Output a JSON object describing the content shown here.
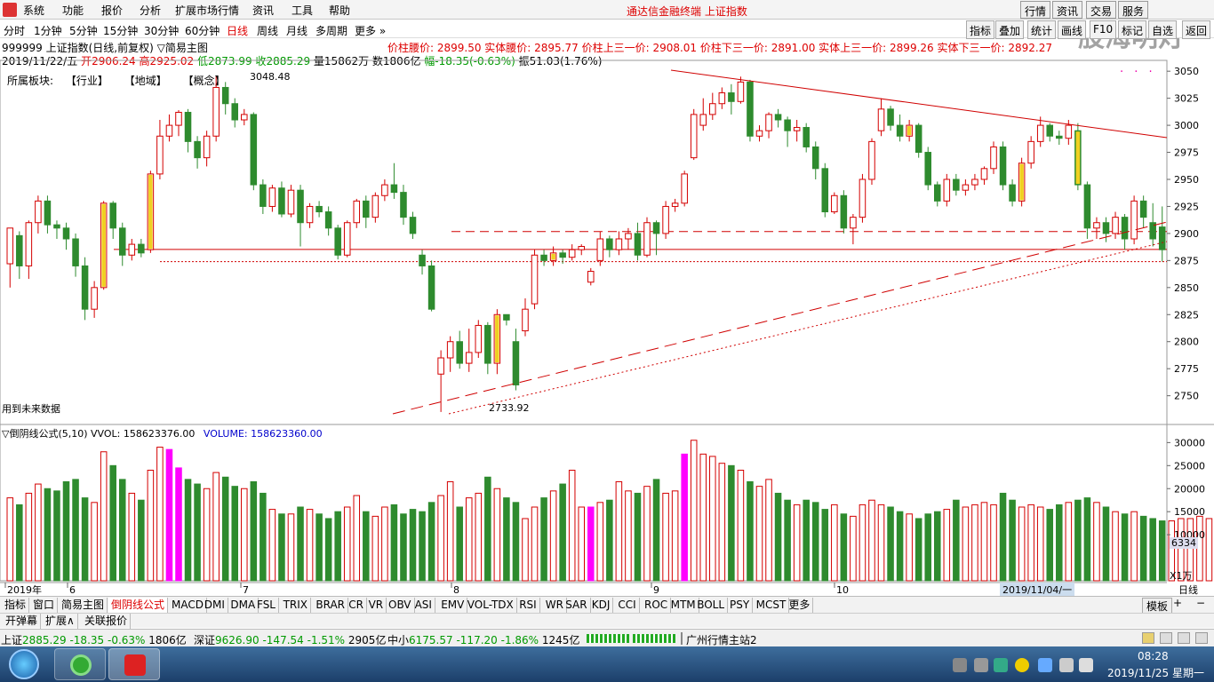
{
  "menu": {
    "items": [
      "系统",
      "功能",
      "报价",
      "分析",
      "扩展市场行情",
      "资讯",
      "工具",
      "帮助"
    ],
    "app_title": "通达信金融终端 上证指数",
    "right_tabs": [
      "行情",
      "资讯",
      "交易",
      "服务"
    ],
    "watermark": "股海明灯"
  },
  "periods": [
    "分时",
    "1分钟",
    "5分钟",
    "15分钟",
    "30分钟",
    "60分钟",
    "日线",
    "周线",
    "月线",
    "多周期",
    "更多"
  ],
  "period_active": "日线",
  "side_tabs": [
    "指标",
    "叠加",
    "统计",
    "画线",
    "F10",
    "标记",
    "自选",
    "返回"
  ],
  "header": {
    "code_name": "999999 上证指数(日线,前复权)",
    "template": "▽简易主图",
    "price_levels": "价柱腰价: 2899.50 实体腰价: 2895.77 价柱上三一价: 2908.01 价柱下三一价: 2891.00 实体上三一价: 2899.26 实体下三一价: 2892.27",
    "date": "2019/11/22/五",
    "open_label": "开",
    "open": "2906.24",
    "high_label": "高",
    "high": "2925.02",
    "low_label": "低",
    "low": "2873.99",
    "close_label": "收",
    "close": "2885.29",
    "vol": "量15862万 数1806亿",
    "change": "幅-18.35(-0.63%)",
    "amplitude": "振51.03(1.76%)",
    "sector_label": "所属板块:",
    "sector_industry": "【行业】",
    "sector_region": "【地域】",
    "sector_concept": "【概念】"
  },
  "annotations": {
    "high_label": "3048.48",
    "low_label": "2733.92",
    "future_data_note": "用到未来数据"
  },
  "volume_panel": {
    "title": "▽倒阴线公式(5,10) VVOL: 158623376.00",
    "volume_label": "VOLUME: 158623360.00",
    "current_value": "6334",
    "scale_unit": "X1万"
  },
  "x_axis": {
    "labels": [
      "2019年",
      "6",
      "7",
      "8",
      "9",
      "10"
    ],
    "cursor_date": "2019/11/04/一",
    "period": "日线"
  },
  "indicator_tabs": [
    "指标",
    "窗口",
    "简易主图",
    "倒阴线公式",
    "MACD",
    "DMI",
    "DMA",
    "FSL",
    "TRIX",
    "BRAR",
    "CR",
    "VR",
    "OBV",
    "ASI",
    "EMV",
    "VOL-TDX",
    "RSI",
    "WR",
    "SAR",
    "KDJ",
    "CCI",
    "ROC",
    "MTM",
    "BOLL",
    "PSY",
    "MCST",
    "更多"
  ],
  "indicator_active": "倒阴线公式",
  "template_button": "模板",
  "subtabs": [
    "开弹幕",
    "扩展∧",
    "关联报价"
  ],
  "status": {
    "sh_label": "上证",
    "sh_value": "2885.29",
    "sh_change": "-18.35",
    "sh_pct": "-0.63%",
    "sh_amount": "1806亿",
    "sz_label": "深证",
    "sz_value": "9626.90",
    "sz_change": "-147.54",
    "sz_pct": "-1.51%",
    "sz_amount": "2905亿",
    "zx_label": "中小",
    "zx_value": "6175.57",
    "zx_change": "-117.20",
    "zx_pct": "-1.86%",
    "zx_amount": "1245亿",
    "server": "广州行情主站2"
  },
  "taskbar": {
    "time": "08:28",
    "date": "2019/11/25 星期一"
  },
  "colors": {
    "up": "#d40000",
    "down": "#2e8b2e",
    "doji": "#f0d020",
    "magenta": "#ff00ff",
    "accent": "#d00000"
  },
  "chart_data": {
    "type": "candlestick",
    "y_ticks": [
      "3050",
      "3025",
      "3000",
      "2975",
      "2950",
      "2925",
      "2900",
      "2875",
      "2850",
      "2825",
      "2800",
      "2775",
      "2750"
    ],
    "ylim": [
      2730,
      3060
    ],
    "vol_ticks": [
      "30000",
      "25000",
      "20000",
      "15000",
      "10000"
    ],
    "vol_ylim": [
      0,
      32000
    ],
    "candles": [
      [
        2872,
        2905,
        2850,
        2900
      ],
      [
        2898,
        2870,
        2858,
        2902
      ],
      [
        2870,
        2910,
        2858,
        2912
      ],
      [
        2910,
        2930,
        2900,
        2935
      ],
      [
        2930,
        2908,
        2900,
        2935
      ],
      [
        2908,
        2905,
        2895,
        2912
      ],
      [
        2905,
        2895,
        2885,
        2910
      ],
      [
        2895,
        2870,
        2860,
        2900
      ],
      [
        2870,
        2830,
        2820,
        2878
      ],
      [
        2830,
        2850,
        2822,
        2856
      ],
      [
        2850,
        2928,
        2848,
        2930
      ],
      [
        2928,
        2905,
        2895,
        2930
      ],
      [
        2905,
        2880,
        2870,
        2910
      ],
      [
        2880,
        2890,
        2875,
        2895
      ],
      [
        2890,
        2882,
        2878,
        2895
      ],
      [
        2885,
        2955,
        2882,
        2958
      ],
      [
        2955,
        2990,
        2950,
        3005
      ],
      [
        2990,
        3000,
        2985,
        3010
      ],
      [
        3000,
        3012,
        2990,
        3014
      ],
      [
        3012,
        2985,
        2975,
        3015
      ],
      [
        2985,
        2970,
        2960,
        2990
      ],
      [
        2970,
        2990,
        2962,
        2995
      ],
      [
        2990,
        3035,
        2985,
        3045
      ],
      [
        3035,
        3020,
        3010,
        3040
      ],
      [
        3020,
        3005,
        2998,
        3025
      ],
      [
        3005,
        3010,
        3000,
        3015
      ],
      [
        3010,
        2945,
        2940,
        3012
      ],
      [
        2945,
        2925,
        2918,
        2950
      ],
      [
        2925,
        2942,
        2920,
        2945
      ],
      [
        2942,
        2918,
        2915,
        2948
      ],
      [
        2918,
        2940,
        2915,
        2945
      ],
      [
        2940,
        2910,
        2888,
        2945
      ],
      [
        2910,
        2925,
        2905,
        2928
      ],
      [
        2925,
        2920,
        2915,
        2930
      ],
      [
        2920,
        2905,
        2898,
        2925
      ],
      [
        2905,
        2880,
        2876,
        2908
      ],
      [
        2880,
        2910,
        2878,
        2912
      ],
      [
        2910,
        2930,
        2905,
        2932
      ],
      [
        2930,
        2915,
        2905,
        2935
      ],
      [
        2915,
        2935,
        2910,
        2938
      ],
      [
        2935,
        2945,
        2930,
        2950
      ],
      [
        2945,
        2938,
        2932,
        2965
      ],
      [
        2938,
        2915,
        2908,
        2945
      ],
      [
        2915,
        2900,
        2895,
        2920
      ],
      [
        2880,
        2870,
        2862,
        2885
      ],
      [
        2870,
        2830,
        2828,
        2875
      ],
      [
        2770,
        2785,
        2735,
        2792
      ],
      [
        2785,
        2800,
        2772,
        2805
      ],
      [
        2800,
        2780,
        2775,
        2810
      ],
      [
        2780,
        2790,
        2772,
        2812
      ],
      [
        2790,
        2815,
        2785,
        2820
      ],
      [
        2815,
        2780,
        2770,
        2818
      ],
      [
        2780,
        2825,
        2770,
        2830
      ],
      [
        2825,
        2820,
        2815,
        2825
      ],
      [
        2800,
        2760,
        2755,
        2812
      ],
      [
        2810,
        2830,
        2805,
        2840
      ],
      [
        2835,
        2880,
        2830,
        2885
      ],
      [
        2880,
        2875,
        2870,
        2885
      ],
      [
        2875,
        2882,
        2870,
        2888
      ],
      [
        2882,
        2878,
        2872,
        2885
      ],
      [
        2878,
        2885,
        2875,
        2890
      ],
      [
        2885,
        2888,
        2880,
        2890
      ],
      [
        2855,
        2865,
        2852,
        2868
      ],
      [
        2875,
        2895,
        2870,
        2902
      ],
      [
        2895,
        2885,
        2878,
        2898
      ],
      [
        2885,
        2895,
        2880,
        2902
      ],
      [
        2895,
        2900,
        2885,
        2905
      ],
      [
        2900,
        2880,
        2875,
        2910
      ],
      [
        2880,
        2910,
        2878,
        2915
      ],
      [
        2910,
        2900,
        2880,
        2912
      ],
      [
        2900,
        2925,
        2895,
        2930
      ],
      [
        2925,
        2928,
        2920,
        2932
      ],
      [
        2928,
        2955,
        2925,
        2958
      ],
      [
        2970,
        3010,
        2968,
        3015
      ],
      [
        3000,
        3010,
        2995,
        3025
      ],
      [
        3010,
        3020,
        3005,
        3030
      ],
      [
        3020,
        3030,
        3015,
        3035
      ],
      [
        3030,
        3022,
        3010,
        3038
      ],
      [
        3022,
        3040,
        3020,
        3045
      ],
      [
        3040,
        2990,
        2985,
        3042
      ],
      [
        2990,
        2995,
        2985,
        3000
      ],
      [
        2995,
        3010,
        2988,
        3012
      ],
      [
        3010,
        3005,
        2998,
        3015
      ],
      [
        3005,
        2995,
        2980,
        3008
      ],
      [
        2995,
        2998,
        2985,
        3005
      ],
      [
        2998,
        2980,
        2975,
        3002
      ],
      [
        2980,
        2960,
        2950,
        2985
      ],
      [
        2960,
        2920,
        2915,
        2965
      ],
      [
        2920,
        2935,
        2918,
        2938
      ],
      [
        2935,
        2905,
        2900,
        2940
      ],
      [
        2905,
        2915,
        2890,
        2918
      ],
      [
        2915,
        2950,
        2910,
        2955
      ],
      [
        2950,
        2985,
        2945,
        2988
      ],
      [
        2995,
        3015,
        2990,
        3025
      ],
      [
        3015,
        3000,
        2995,
        3018
      ],
      [
        3000,
        2990,
        2985,
        3010
      ],
      [
        2990,
        3000,
        2985,
        3005
      ],
      [
        3000,
        2975,
        2970,
        3002
      ],
      [
        2975,
        2945,
        2940,
        2980
      ],
      [
        2945,
        2930,
        2925,
        2948
      ],
      [
        2930,
        2950,
        2925,
        2955
      ],
      [
        2950,
        2940,
        2935,
        2955
      ],
      [
        2940,
        2945,
        2935,
        2950
      ],
      [
        2945,
        2950,
        2940,
        2955
      ],
      [
        2950,
        2960,
        2945,
        2962
      ],
      [
        2960,
        2980,
        2955,
        2985
      ],
      [
        2980,
        2945,
        2940,
        2985
      ],
      [
        2945,
        2930,
        2925,
        2950
      ],
      [
        2930,
        2965,
        2925,
        2970
      ],
      [
        2965,
        2985,
        2960,
        2990
      ],
      [
        2985,
        3000,
        2980,
        3008
      ],
      [
        3000,
        2990,
        2985,
        3002
      ],
      [
        2990,
        2988,
        2982,
        2995
      ],
      [
        2988,
        3000,
        2982,
        3005
      ],
      [
        2995,
        2945,
        2940,
        3002
      ],
      [
        2945,
        2905,
        2895,
        2948
      ],
      [
        2905,
        2910,
        2895,
        2915
      ],
      [
        2910,
        2900,
        2892,
        2915
      ],
      [
        2900,
        2915,
        2895,
        2920
      ],
      [
        2915,
        2895,
        2885,
        2918
      ],
      [
        2895,
        2930,
        2890,
        2935
      ],
      [
        2930,
        2915,
        2905,
        2935
      ],
      [
        2910,
        2895,
        2888,
        2928
      ],
      [
        2906,
        2885,
        2874,
        2925
      ]
    ],
    "volumes": [
      18000,
      16500,
      19000,
      21000,
      20000,
      19500,
      21500,
      22000,
      18000,
      17000,
      28000,
      25000,
      22000,
      19000,
      17500,
      24000,
      29000,
      28500,
      24500,
      22000,
      21000,
      20000,
      23500,
      22500,
      20500,
      20000,
      21500,
      19000,
      15500,
      14500,
      14500,
      16000,
      15500,
      14500,
      13500,
      15000,
      16000,
      18500,
      15000,
      14000,
      16000,
      16500,
      14500,
      15500,
      15000,
      17000,
      18500,
      21500,
      16000,
      18000,
      19000,
      22500,
      20000,
      18000,
      17000,
      13500,
      16000,
      18000,
      19500,
      21000,
      24000,
      16000,
      16000,
      17000,
      17500,
      21500,
      19500,
      19000,
      20500,
      22000,
      19000,
      19500,
      27500,
      30500,
      27500,
      27000,
      25500,
      25000,
      24000,
      21500,
      20500,
      22000,
      19000,
      17500,
      16500,
      17500,
      17000,
      15500,
      16500,
      14500,
      14000,
      16500,
      17500,
      16500,
      16000,
      15000,
      14500,
      13500,
      14500,
      15000,
      15500,
      17500,
      16000,
      16500,
      17000,
      16500,
      19000,
      17500,
      16000,
      16500,
      16000,
      15500,
      16500,
      17000,
      17500,
      18000,
      17000,
      16000,
      15000,
      14500,
      15000,
      14000,
      13500,
      13000,
      13000,
      13500,
      13500,
      14000,
      13500,
      12500,
      16000
    ],
    "magenta_bars": [
      17,
      18,
      62,
      72
    ],
    "reference_lines": {
      "solid_horizontal": 2885.29,
      "dashed_horizontal": 2901.8,
      "dotted_horizontal": 2873.99
    },
    "x_labels": [
      "2019年",
      "6",
      "7",
      "8",
      "9",
      "10"
    ]
  }
}
